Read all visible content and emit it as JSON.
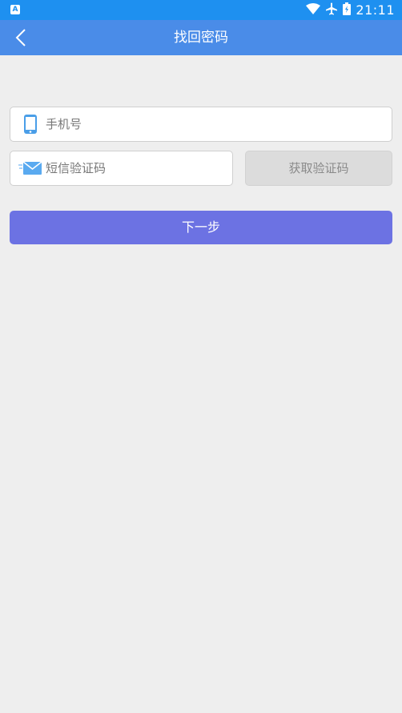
{
  "status_bar": {
    "app_icon_letter": "A",
    "time": "21:11",
    "icons": [
      "wifi-icon",
      "airplane-icon",
      "battery-icon"
    ]
  },
  "header": {
    "title": "找回密码",
    "back_icon": "chevron-left-icon"
  },
  "form": {
    "phone": {
      "placeholder": "手机号",
      "value": "",
      "icon": "phone-icon"
    },
    "sms_code": {
      "placeholder": "短信验证码",
      "value": "",
      "icon": "envelope-icon"
    },
    "get_code_label": "获取验证码",
    "next_label": "下一步"
  },
  "colors": {
    "status_bar": "#1e90f0",
    "app_bar": "#4a8ce8",
    "background": "#eeeeee",
    "primary_button": "#6c72e3",
    "disabled_button": "#dcdcdc"
  }
}
